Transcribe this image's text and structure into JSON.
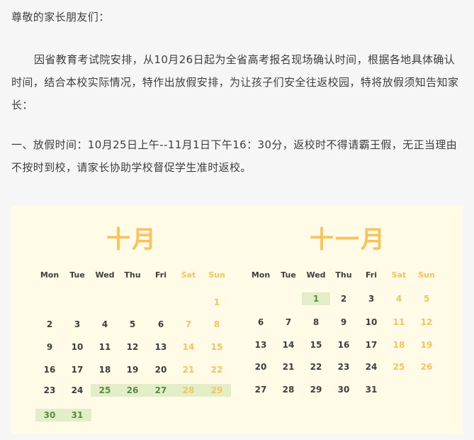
{
  "greeting": "尊敬的家长朋友们：",
  "paragraph1": "因省教育考试院安排，从10月26日起为全省高考报名现场确认时间，根据各地具体确认时间，结合本校实际情况，特作出放假安排，为让孩子们安全往返校园，特将放假须知告知家长：",
  "paragraph2": "一、放假时间：10月25日上午--11月1日下午16：30分，返校时不得请霸王假，无正当理由不按时到校，请家长协助学校督促学生准时返校。",
  "colors": {
    "panel_bg": "#fffbe6",
    "title": "#f9c25d",
    "weekend": "#f9c25d",
    "highlight_bg": "#e2eec8",
    "highlight_text": "#5b8a3e"
  },
  "calendars": {
    "weekdays": [
      "Mon",
      "Tue",
      "Wed",
      "Thu",
      "Fri",
      "Sat",
      "Sun"
    ],
    "october": {
      "title": "十月",
      "days": [
        [
          "",
          "",
          "",
          "",
          "",
          "",
          "1"
        ],
        [
          "2",
          "3",
          "4",
          "5",
          "6",
          "7",
          "8"
        ],
        [
          "9",
          "10",
          "11",
          "12",
          "13",
          "14",
          "15"
        ],
        [
          "16",
          "17",
          "18",
          "19",
          "20",
          "21",
          "22"
        ],
        [
          "23",
          "24",
          "25",
          "26",
          "27",
          "28",
          "29"
        ],
        [
          "30",
          "31",
          "",
          "",
          "",
          "",
          ""
        ]
      ],
      "highlighted": [
        "25",
        "26",
        "27",
        "28",
        "29",
        "30",
        "31"
      ]
    },
    "november": {
      "title": "十一月",
      "days": [
        [
          "",
          "",
          "1",
          "2",
          "3",
          "4",
          "5"
        ],
        [
          "6",
          "7",
          "8",
          "9",
          "10",
          "11",
          "12"
        ],
        [
          "13",
          "14",
          "15",
          "16",
          "17",
          "18",
          "19"
        ],
        [
          "20",
          "21",
          "22",
          "23",
          "24",
          "25",
          "26"
        ],
        [
          "27",
          "28",
          "29",
          "30",
          "31",
          "",
          ""
        ]
      ],
      "highlighted": [
        "1"
      ]
    }
  }
}
